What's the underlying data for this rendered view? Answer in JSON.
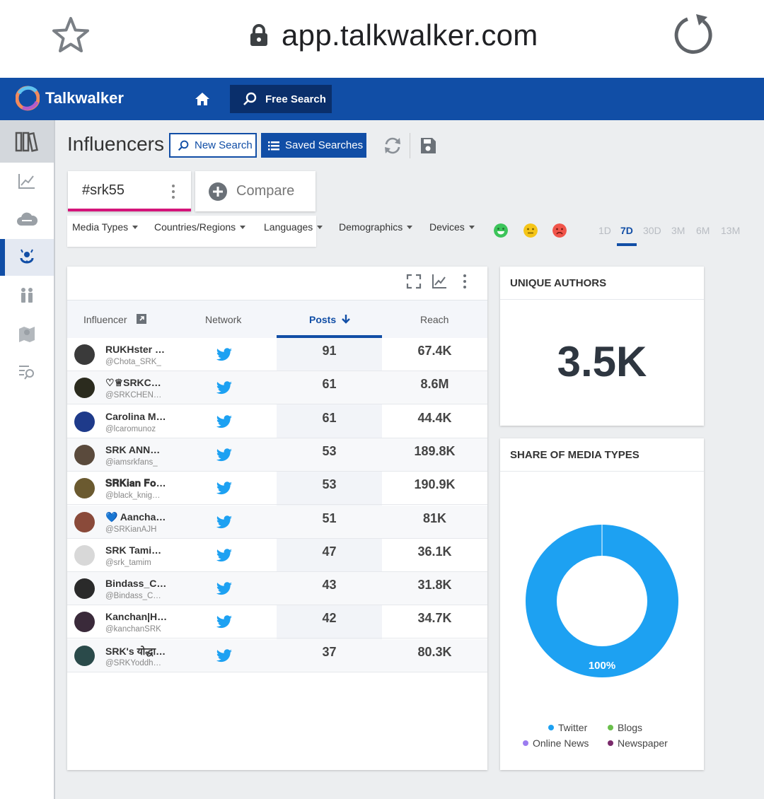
{
  "browser": {
    "url": "app.talkwalker.com"
  },
  "header": {
    "brand": "Talkwalker",
    "free_search": "Free Search"
  },
  "page": {
    "title": "Influencers",
    "new_search": "New Search",
    "saved_searches": "Saved Searches"
  },
  "query": {
    "tab_label": "#srk55",
    "compare_label": "Compare"
  },
  "filters": [
    "Media Types",
    "Countries/Regions",
    "Languages",
    "Demographics",
    "Devices"
  ],
  "sentiment": [
    {
      "name": "positive",
      "color": "#3cc45a"
    },
    {
      "name": "neutral",
      "color": "#f5c518"
    },
    {
      "name": "negative",
      "color": "#f0544a"
    }
  ],
  "time_ranges": [
    "1D",
    "7D",
    "30D",
    "3M",
    "6M",
    "13M"
  ],
  "active_range": "7D",
  "table": {
    "headers": {
      "influencer": "Influencer",
      "network": "Network",
      "posts": "Posts",
      "reach": "Reach"
    },
    "sorted_by": "posts",
    "rows": [
      {
        "name": "RUKHster …",
        "handle": "@Chota_SRK_",
        "network": "twitter",
        "posts": "91",
        "reach": "67.4K"
      },
      {
        "name": "♡♕SRKC…",
        "handle": "@SRKCHEN…",
        "network": "twitter",
        "posts": "61",
        "reach": "8.6M"
      },
      {
        "name": "Carolina M…",
        "handle": "@lcaromunoz",
        "network": "twitter",
        "posts": "61",
        "reach": "44.4K"
      },
      {
        "name": "SRK ANNO…",
        "handle": "@iamsrkfans_",
        "network": "twitter",
        "posts": "53",
        "reach": "189.8K"
      },
      {
        "name": "𝐒𝐑𝐊𝐢𝐚𝐧 𝐅𝐨…",
        "handle": "@black_knig…",
        "network": "twitter",
        "posts": "53",
        "reach": "190.9K"
      },
      {
        "name": "💙 Aancha…",
        "handle": "@SRKianAJH",
        "network": "twitter",
        "posts": "51",
        "reach": "81K"
      },
      {
        "name": "SRK Tami…",
        "handle": "@srk_tamim",
        "network": "twitter",
        "posts": "47",
        "reach": "36.1K"
      },
      {
        "name": "Bindass_C…",
        "handle": "@Bindass_C…",
        "network": "twitter",
        "posts": "43",
        "reach": "31.8K"
      },
      {
        "name": "Kanchan|H…",
        "handle": "@kanchanSRK",
        "network": "twitter",
        "posts": "42",
        "reach": "34.7K"
      },
      {
        "name": "SRK's योद्धा(…",
        "handle": "@SRKYoddh…",
        "network": "twitter",
        "posts": "37",
        "reach": "80.3K"
      }
    ]
  },
  "unique_authors": {
    "title": "UNIQUE AUTHORS",
    "value": "3.5K"
  },
  "chart_data": {
    "type": "pie",
    "title": "SHARE OF MEDIA TYPES",
    "categories": [
      "Twitter",
      "Blogs",
      "Online News",
      "Newspaper"
    ],
    "values": [
      100,
      0,
      0,
      0
    ],
    "colors": [
      "#1da1f2",
      "#6abf4b",
      "#9b7cf0",
      "#7a2a6b"
    ],
    "data_label": "100%",
    "legend_position": "bottom"
  },
  "colors": {
    "brand_blue": "#114ea6",
    "query_accent": "#d4147a",
    "twitter": "#1da1f2"
  }
}
